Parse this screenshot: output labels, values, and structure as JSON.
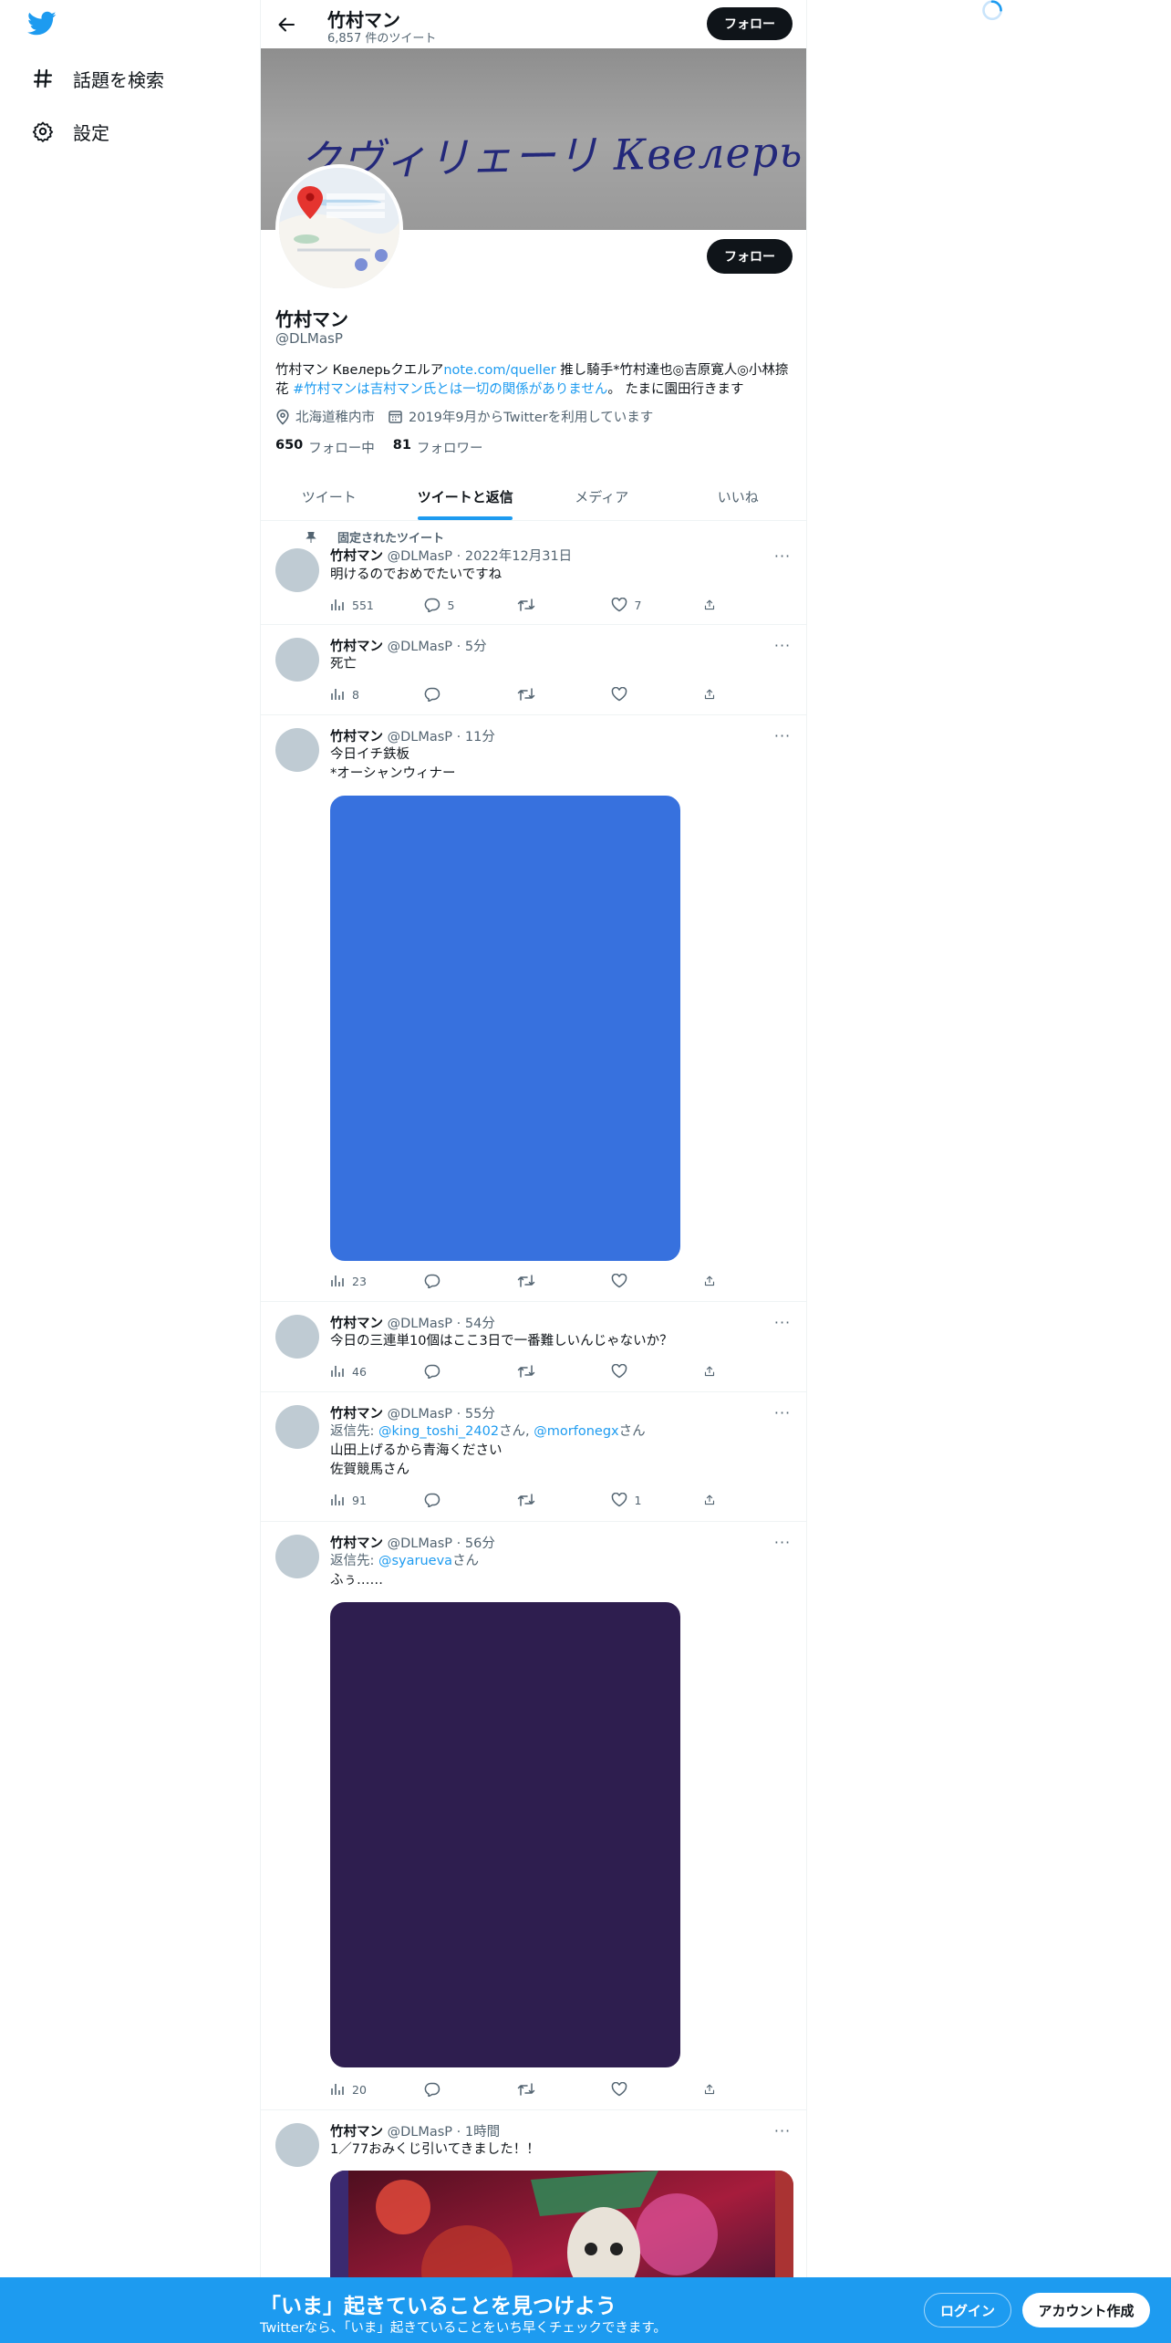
{
  "nav": {
    "explore_label": "話題を検索",
    "settings_label": "設定"
  },
  "header": {
    "name": "竹村マン",
    "tweet_count": "6,857 件のツイート",
    "follow_label": "フォロー"
  },
  "banner": {
    "handwriting": "クヴィリェーリ Квелерь"
  },
  "profile": {
    "name": "竹村マン",
    "handle": "@DLMasP",
    "follow_label": "フォロー",
    "bio_text_1": "竹村マン Квелерьクエルア",
    "bio_link": "note.com/queller",
    "bio_text_2": " 推し騎手*竹村達也◎吉原寛人◎小林捺花 ",
    "bio_hashtag": "#竹村マンは吉村マン氏とは一切の関係がありません",
    "bio_text_3": "。 たまに園田行きます",
    "location": "北海道稚内市",
    "joined": "2019年9月からTwitterを利用しています",
    "following_count": "650",
    "following_label": "フォロー中",
    "followers_count": "81",
    "followers_label": "フォロワー"
  },
  "tabs": [
    {
      "label": "ツイート",
      "active": false
    },
    {
      "label": "ツイートと返信",
      "active": true
    },
    {
      "label": "メディア",
      "active": false
    },
    {
      "label": "いいね",
      "active": false
    }
  ],
  "tweets": [
    {
      "pinned_label": "固定されたツイート",
      "name": "竹村マン",
      "meta": "@DLMasP · 2022年12月31日",
      "text": "明けるのでおめでたいですね",
      "views": "551",
      "replies": "5",
      "retweets": "",
      "likes": "7"
    },
    {
      "name": "竹村マン",
      "meta": "@DLMasP · 5分",
      "text": "死亡",
      "views": "8",
      "replies": "",
      "retweets": "",
      "likes": ""
    },
    {
      "name": "竹村マン",
      "meta": "@DLMasP · 11分",
      "text_line1": "今日イチ鉄板",
      "text_line2": "*オーシャンウィナー",
      "media_color": "#3771de",
      "views": "23",
      "replies": "",
      "retweets": "",
      "likes": ""
    },
    {
      "name": "竹村マン",
      "meta": "@DLMasP · 54分",
      "text": "今日の三連単10個はここ3日で一番難しいんじゃないか？",
      "views": "46",
      "replies": "",
      "retweets": "",
      "likes": ""
    },
    {
      "name": "竹村マン",
      "meta": "@DLMasP · 55分",
      "reply_prefix": "返信先: ",
      "reply_user1": "@king_toshi_2402",
      "reply_mid": "さん, ",
      "reply_user2": "@morfonegx",
      "reply_suffix": "さん",
      "text_line1": "山田上げるから青海ください",
      "text_line2": "佐賀競馬さん",
      "views": "91",
      "replies": "",
      "retweets": "",
      "likes": "1"
    },
    {
      "name": "竹村マン",
      "meta": "@DLMasP · 56分",
      "reply_prefix": "返信先: ",
      "reply_user1": "@syarueva",
      "reply_suffix": "さん",
      "text": "ふぅ……",
      "media_color": "#2e1e4f",
      "views": "20",
      "replies": "",
      "retweets": "",
      "likes": ""
    },
    {
      "name": "竹村マン",
      "meta": "@DLMasP · 1時間",
      "text": "1／77おみくじ引いてきました！！"
    }
  ],
  "bottom_bar": {
    "title": "「いま」起きていることを見つけよう",
    "subtitle": "Twitterなら、「いま」起きていることをいち早くチェックできます。",
    "login_label": "ログイン",
    "signup_label": "アカウント作成"
  },
  "colors": {
    "accent": "#1d9bf0",
    "text": "#0f1419",
    "muted": "#536471"
  }
}
